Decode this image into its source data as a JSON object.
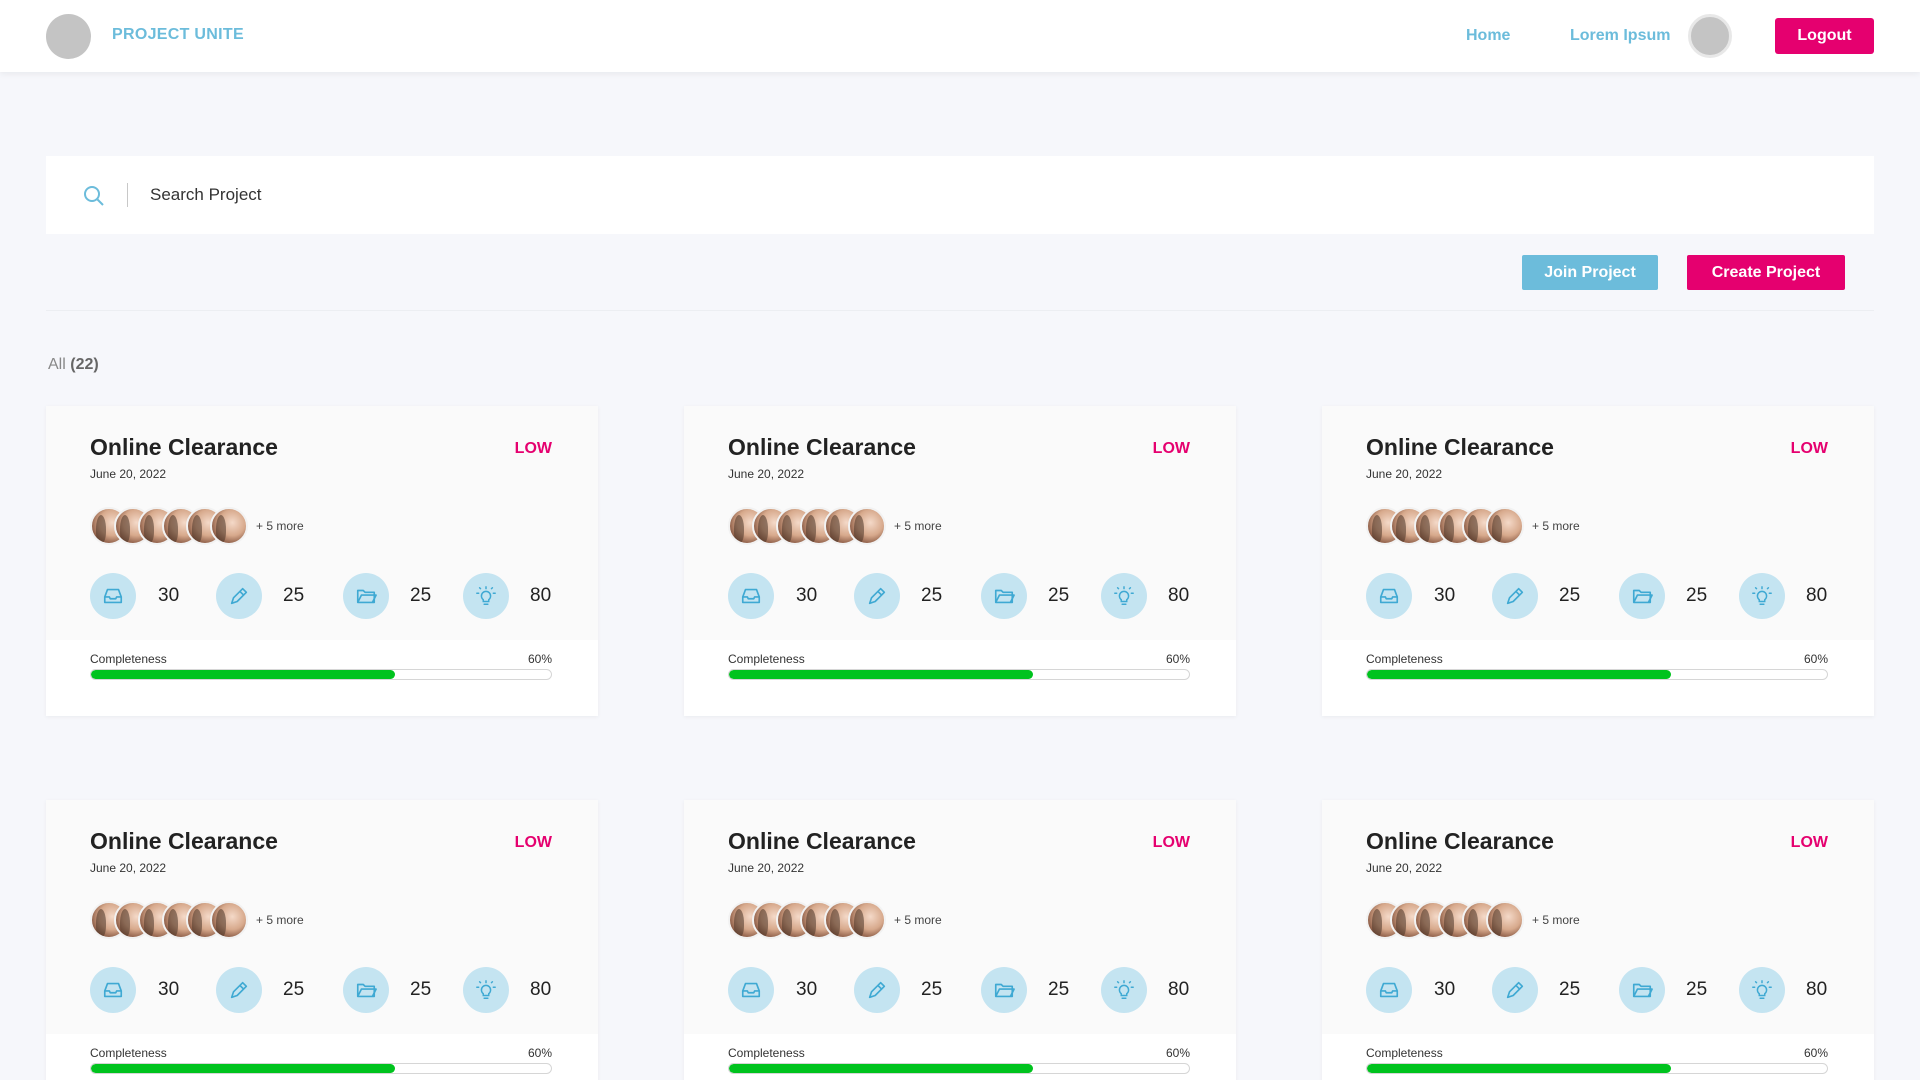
{
  "header": {
    "brand": "PROJECT UNITE",
    "nav": [
      {
        "label": "Home"
      },
      {
        "label": "Lorem Ipsum"
      }
    ],
    "logout_label": "Logout"
  },
  "search": {
    "placeholder": "Search Project",
    "icon": "search-icon"
  },
  "actions": {
    "join_label": "Join Project",
    "create_label": "Create Project"
  },
  "filter": {
    "label": "All",
    "count": "(22)"
  },
  "colors": {
    "accent_blue": "#6cbcdb",
    "accent_pink": "#e5006f",
    "progress_green": "#00c31e",
    "icon_bg": "#c4e4f1"
  },
  "cards": [
    {
      "title": "Online Clearance",
      "priority": "LOW",
      "date": "June 20, 2022",
      "more": "+ 5 more",
      "stats": [
        {
          "icon": "inbox-icon",
          "value": "30"
        },
        {
          "icon": "pencil-icon",
          "value": "25"
        },
        {
          "icon": "folder-icon",
          "value": "25"
        },
        {
          "icon": "lightbulb-icon",
          "value": "80"
        }
      ],
      "completeness_label": "Completeness",
      "completeness_pct": "60%",
      "progress": 0.66
    },
    {
      "title": "Online Clearance",
      "priority": "LOW",
      "date": "June 20, 2022",
      "more": "+ 5 more",
      "stats": [
        {
          "icon": "inbox-icon",
          "value": "30"
        },
        {
          "icon": "pencil-icon",
          "value": "25"
        },
        {
          "icon": "folder-icon",
          "value": "25"
        },
        {
          "icon": "lightbulb-icon",
          "value": "80"
        }
      ],
      "completeness_label": "Completeness",
      "completeness_pct": "60%",
      "progress": 0.66
    },
    {
      "title": "Online Clearance",
      "priority": "LOW",
      "date": "June 20, 2022",
      "more": "+ 5 more",
      "stats": [
        {
          "icon": "inbox-icon",
          "value": "30"
        },
        {
          "icon": "pencil-icon",
          "value": "25"
        },
        {
          "icon": "folder-icon",
          "value": "25"
        },
        {
          "icon": "lightbulb-icon",
          "value": "80"
        }
      ],
      "completeness_label": "Completeness",
      "completeness_pct": "60%",
      "progress": 0.66
    },
    {
      "title": "Online Clearance",
      "priority": "LOW",
      "date": "June 20, 2022",
      "more": "+ 5 more",
      "stats": [
        {
          "icon": "inbox-icon",
          "value": "30"
        },
        {
          "icon": "pencil-icon",
          "value": "25"
        },
        {
          "icon": "folder-icon",
          "value": "25"
        },
        {
          "icon": "lightbulb-icon",
          "value": "80"
        }
      ],
      "completeness_label": "Completeness",
      "completeness_pct": "60%",
      "progress": 0.66
    },
    {
      "title": "Online Clearance",
      "priority": "LOW",
      "date": "June 20, 2022",
      "more": "+ 5 more",
      "stats": [
        {
          "icon": "inbox-icon",
          "value": "30"
        },
        {
          "icon": "pencil-icon",
          "value": "25"
        },
        {
          "icon": "folder-icon",
          "value": "25"
        },
        {
          "icon": "lightbulb-icon",
          "value": "80"
        }
      ],
      "completeness_label": "Completeness",
      "completeness_pct": "60%",
      "progress": 0.66
    },
    {
      "title": "Online Clearance",
      "priority": "LOW",
      "date": "June 20, 2022",
      "more": "+ 5 more",
      "stats": [
        {
          "icon": "inbox-icon",
          "value": "30"
        },
        {
          "icon": "pencil-icon",
          "value": "25"
        },
        {
          "icon": "folder-icon",
          "value": "25"
        },
        {
          "icon": "lightbulb-icon",
          "value": "80"
        }
      ],
      "completeness_label": "Completeness",
      "completeness_pct": "60%",
      "progress": 0.66
    }
  ]
}
